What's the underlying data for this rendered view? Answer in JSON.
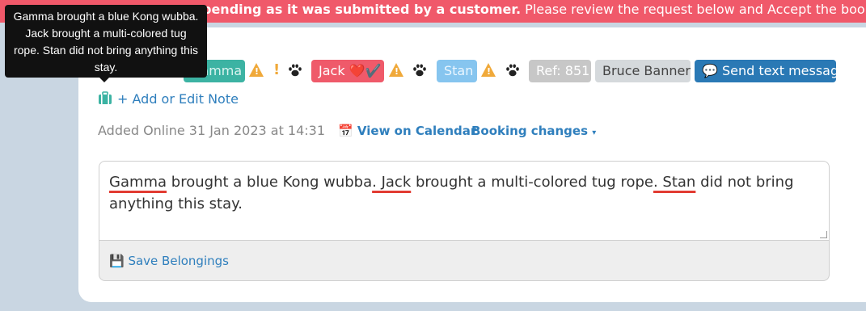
{
  "alert": {
    "bold_text": "pending as it was submitted by a customer.",
    "text": " Please review the request below and Accept the booking to accept"
  },
  "tooltip": {
    "text": "Gamma brought a blue Kong wubba. Jack brought a multi-colored tug rope. Stan did not bring anything this stay."
  },
  "badges": {
    "gamma": "Gamma",
    "jack": "Jack",
    "jack_icons": "❤️✔️",
    "stan": "Stan",
    "ref": "Ref: 851",
    "owner": "Bruce Banner",
    "send_text": "Send text message"
  },
  "note_link": "+ Add or Edit Note",
  "meta": {
    "added": "Added Online 31 Jan 2023 at 14:31",
    "view_calendar": "View on Calendar",
    "booking_changes": "Booking changes"
  },
  "belongings": {
    "segments": [
      {
        "text": "Gamma",
        "underline": true
      },
      {
        "text": " brought a blue Kong wubba",
        "underline": false
      },
      {
        "text": ". Jack",
        "underline": true
      },
      {
        "text": " brought a multi-colored tug rope",
        "underline": false
      },
      {
        "text": ". Stan",
        "underline": true
      },
      {
        "text": " did not bring anything this stay.",
        "underline": false
      }
    ]
  },
  "save_button": "Save Belongings",
  "colors": {
    "alert": "#f0596a",
    "gamma": "#3cb3a3",
    "jack": "#ef5a6a",
    "stan": "#86c5ef",
    "ref": "#c7c7c7",
    "owner": "#d5d9dc",
    "send": "#2a79b5",
    "warn": "#f0a93a",
    "link": "#2f7fbd"
  }
}
